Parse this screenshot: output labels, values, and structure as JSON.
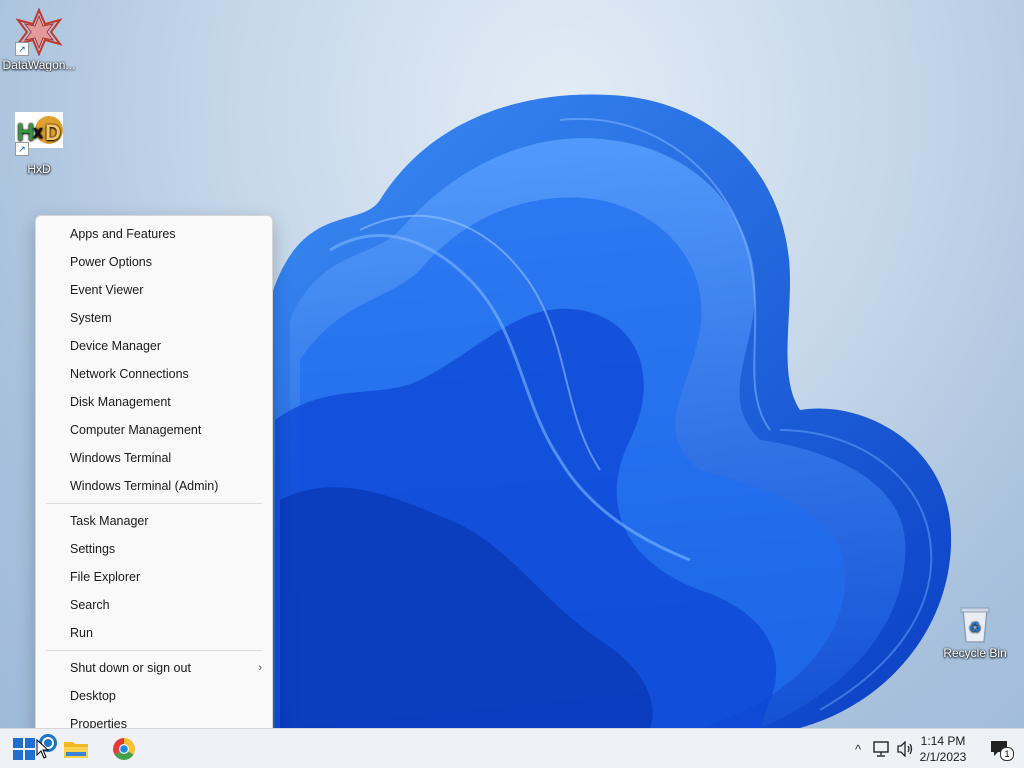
{
  "desktop": {
    "icons": [
      {
        "label": "DataWagon..."
      },
      {
        "label": "HxD"
      },
      {
        "label": "Recycle Bin"
      }
    ]
  },
  "context_menu": {
    "group1": [
      "Apps and Features",
      "Power Options",
      "Event Viewer",
      "System",
      "Device Manager",
      "Network Connections",
      "Disk Management",
      "Computer Management",
      "Windows Terminal",
      "Windows Terminal (Admin)"
    ],
    "group2": [
      "Task Manager",
      "Settings",
      "File Explorer",
      "Search",
      "Run"
    ],
    "group3": [
      "Shut down or sign out",
      "Desktop",
      "Properties"
    ],
    "submenu_arrow": "›"
  },
  "taskbar": {
    "time": "1:14 PM",
    "date": "2/1/2023",
    "notification_count": "1",
    "tray_overflow": "^"
  },
  "colors": {
    "wallpaper_bloom": "#1a66e8",
    "taskbar_bg": "#eef1f6",
    "menu_bg": "#f9f9f9",
    "start_blue": "#1f6fd0"
  },
  "icons": [
    "windows-start-icon",
    "search-icon",
    "file-explorer-icon",
    "chrome-icon",
    "chevron-up-icon",
    "network-icon",
    "speaker-icon",
    "notification-icon",
    "recycle-bin-icon"
  ]
}
